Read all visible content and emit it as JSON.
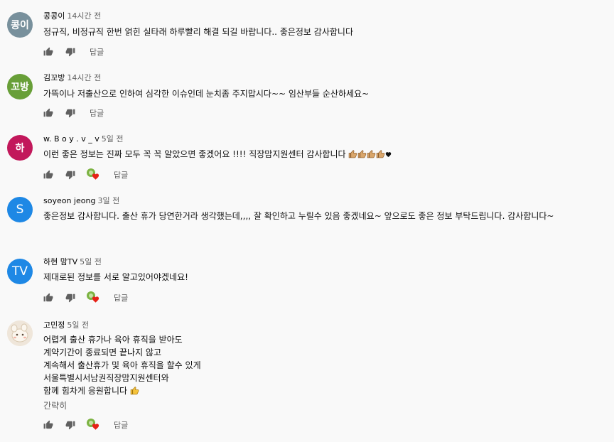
{
  "colors": {
    "background": "#f9f9f9",
    "meta_text": "#606060",
    "creator_heart": "#e62117"
  },
  "comments": [
    {
      "author": "콩콩이",
      "time": "14시간 전",
      "avatar_text": "콩이",
      "avatar_color": "#78909c",
      "lines": [
        "정규직, 비정규직 한번 얽힌 실타래 하루빨리 해결 되길 바랍니다.. 좋은정보 감사합니다"
      ],
      "reply_label": "답글",
      "creator_heart": false
    },
    {
      "author": "김꼬방",
      "time": "14시간 전",
      "avatar_text": "꼬방",
      "avatar_color": "#689f38",
      "lines": [
        "가뜩이나 저출산으로 인하여 심각한 이슈인데 눈치좀 주지맙시다~~ 임산부들 순산하세요~"
      ],
      "reply_label": "답글",
      "creator_heart": false
    },
    {
      "author": "w. B o y . v _ v",
      "time": "5일 전",
      "avatar_text": "하",
      "avatar_color": "#c2185b",
      "lines": [
        "이런 좋은 정보는 진짜 모두 꼭 꼭 알았으면 좋겠어요 !!!! 직장맘지원센터 감사합니다"
      ],
      "trailing_emoji": [
        "thumbs-up-emoji",
        "thumbs-up-emoji",
        "thumbs-up-emoji",
        "thumbs-up-emoji",
        "heart-emoji"
      ],
      "reply_label": "답글",
      "creator_heart": true
    },
    {
      "author": "soyeon jeong",
      "time": "3일 전",
      "avatar_text": "S",
      "avatar_color": "#1e88e5",
      "lines": [
        "좋은정보 감사합니다. 출산 휴가 당연한거라 생각했는데,,,, 잘 확인하고 누릴수 있음 좋겠네요~ 앞으로도 좋은 정보 부탁드립니다. 감사합니다~"
      ],
      "reply_label": "답글",
      "creator_heart": false
    },
    {
      "author": "하현 맘TV",
      "time": "5일 전",
      "avatar_text": "TV",
      "avatar_color": "#1e88e5",
      "lines": [
        "제대로된 정보를 서로 알고있어야겠네요!"
      ],
      "reply_label": "답글",
      "creator_heart": true
    },
    {
      "author": "고민정",
      "time": "5일 전",
      "avatar_text": "",
      "avatar_color": "#efe6da",
      "lines": [
        "어렵게 출산 휴가나 육아 휴직을 받아도",
        "계약기간이 종료되면 끝나지 않고",
        "계속해서 출산휴가 및 육아 휴직을 할수 있게",
        "서울특별시서남권직장맘지원센터와",
        "함께 힘차게 응원합니다"
      ],
      "trailing_emoji": [
        "thumbs-up-emoji"
      ],
      "read_more": "간략히",
      "reply_label": "답글",
      "creator_heart": true
    }
  ]
}
